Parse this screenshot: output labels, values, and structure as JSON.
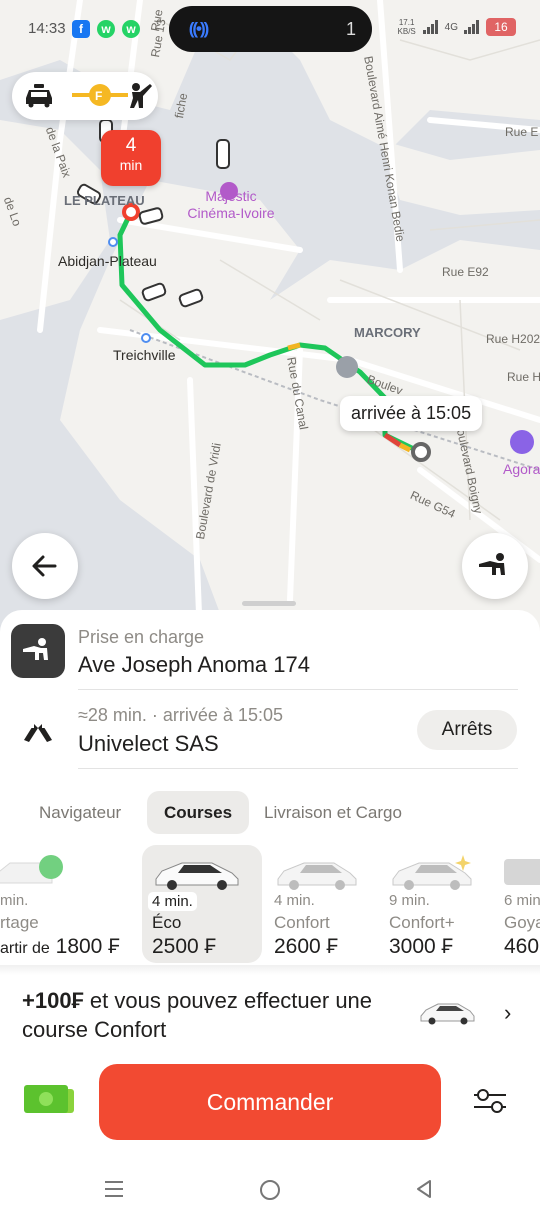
{
  "status_bar": {
    "time": "14:33",
    "apps": [
      "f",
      "w",
      "w"
    ],
    "island_count": "1",
    "speed": "17.1 KB/S",
    "network": "4G",
    "battery": "16"
  },
  "map": {
    "labels": {
      "rue13": "Rue 13",
      "rue_top": "Rue",
      "boulevard_aime": "Boulevard Aimé Henri Konan Bedie",
      "rue_e": "Rue E",
      "rue_e92": "Rue E92",
      "marcory": "MARCORY",
      "rue_h202": "Rue H202",
      "rue_h": "Rue H",
      "plateau": "LE PLATEAU",
      "abidjan_plateau": "Abidjan-Plateau",
      "treichville": "Treichville",
      "majestic": "Majestic Cinéma-Ivoire",
      "rue_du_canal": "Rue du Canal",
      "boulev": "Boulev",
      "boulevard_vridi": "Boulevard de Vridi",
      "rue_g54": "Rue G54",
      "bigny": "Boulevard Boigny",
      "agora": "Agora",
      "de_la_paix": "de la Paix",
      "de_lo": "de Lo",
      "fiche": "fiche"
    },
    "eta_marker": {
      "value": "4",
      "unit": "min"
    },
    "arrival_bubble": "arrivée à 15:05",
    "route_color": "#1ec65a",
    "accent": "#f24a32"
  },
  "tariff_pill": {
    "icons": [
      "taxi-car-icon",
      "electric-fuel-icon",
      "hand-waving-icon"
    ]
  },
  "addresses": {
    "pickup_label": "Prise en charge",
    "pickup_address": "Ave Joseph Anoma 174",
    "destination_meta": "≈28 min. · arrivée à 15:05",
    "destination_address": "Univelect SAS",
    "stops_button": "Arrêts"
  },
  "tabs": [
    {
      "label": "Navigateur",
      "active": false
    },
    {
      "label": "Courses",
      "active": true
    },
    {
      "label": "Livraison et Cargo",
      "active": false
    }
  ],
  "tariffs": [
    {
      "eta": "min.",
      "name": "rtage",
      "prefix": "artir de",
      "price": "1800 ₣",
      "selected": false
    },
    {
      "eta": "4 min.",
      "name": "Éco",
      "prefix": "",
      "price": "2500 ₣",
      "selected": true
    },
    {
      "eta": "4 min.",
      "name": "Confort",
      "prefix": "",
      "price": "2600 ₣",
      "selected": false
    },
    {
      "eta": "9 min.",
      "name": "Confort+",
      "prefix": "",
      "price": "3000 ₣",
      "selected": false
    },
    {
      "eta": "6 min",
      "name": "Goya",
      "prefix": "",
      "price": "460",
      "selected": false
    }
  ],
  "promo": {
    "highlight": "+100₣",
    "text": " et vous pouvez effectuer une course Confort"
  },
  "order": {
    "button_label": "Commander",
    "payment_color": "#6ad13b"
  }
}
